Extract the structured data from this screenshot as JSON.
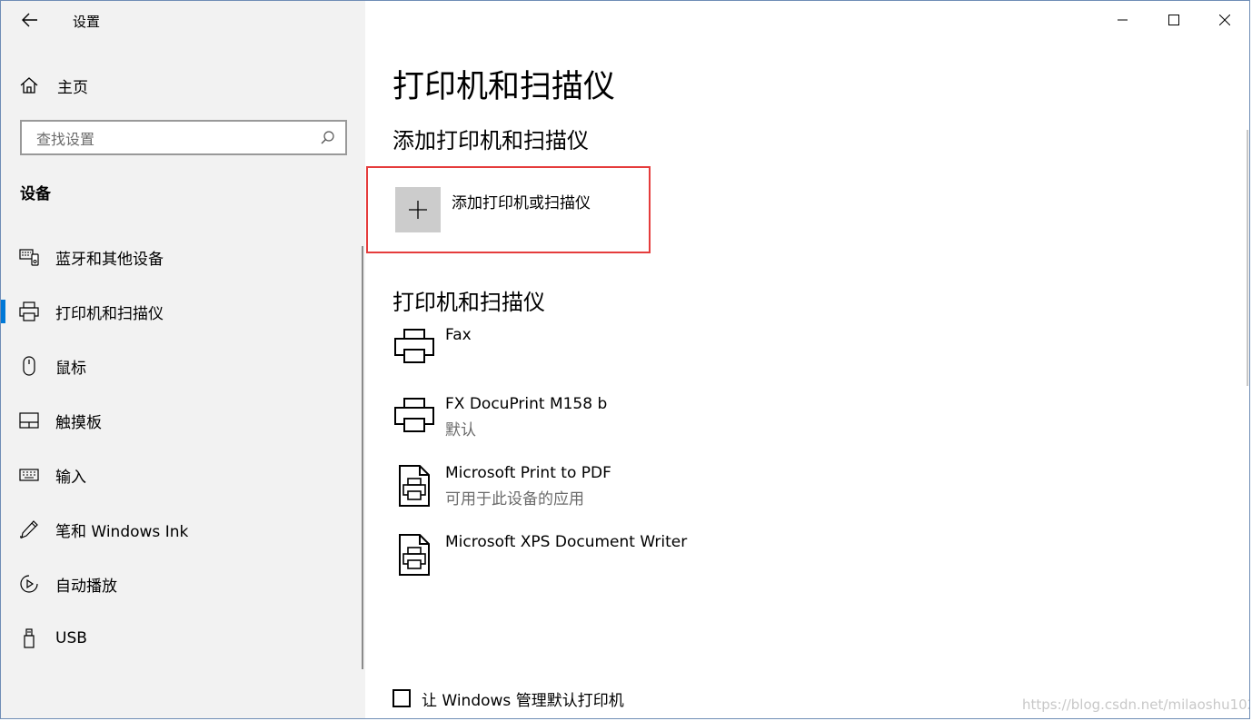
{
  "window": {
    "title": "设置",
    "border_color": "#6f8db6"
  },
  "sidebar": {
    "home_label": "主页",
    "search_placeholder": "查找设置",
    "section_title": "设备",
    "items": [
      {
        "label": "蓝牙和其他设备",
        "icon": "bluetooth-devices-icon",
        "selected": false
      },
      {
        "label": "打印机和扫描仪",
        "icon": "printer-icon",
        "selected": true
      },
      {
        "label": "鼠标",
        "icon": "mouse-icon",
        "selected": false
      },
      {
        "label": "触摸板",
        "icon": "touchpad-icon",
        "selected": false
      },
      {
        "label": "输入",
        "icon": "keyboard-icon",
        "selected": false
      },
      {
        "label": "笔和 Windows Ink",
        "icon": "pen-icon",
        "selected": false
      },
      {
        "label": "自动播放",
        "icon": "autoplay-icon",
        "selected": false
      },
      {
        "label": "USB",
        "icon": "usb-icon",
        "selected": false
      }
    ],
    "accent_color": "#0078d7"
  },
  "main": {
    "title": "打印机和扫描仪",
    "add_section_title": "添加打印机和扫描仪",
    "add_button_label": "添加打印机或扫描仪",
    "list_title": "打印机和扫描仪",
    "devices": [
      {
        "name": "Fax",
        "status": "",
        "icon": "printer-icon"
      },
      {
        "name": "FX DocuPrint M158 b",
        "status": "默认",
        "icon": "printer-icon"
      },
      {
        "name": "Microsoft Print to PDF",
        "status": "可用于此设备的应用",
        "icon": "document-printer-icon"
      },
      {
        "name": "Microsoft XPS Document Writer",
        "status": "",
        "icon": "document-printer-icon"
      }
    ],
    "checkbox_label": "让 Windows 管理默认打印机",
    "checkbox_checked": false,
    "highlight_color": "#e53c3c"
  },
  "watermark": "https://blog.csdn.net/milaoshu1020"
}
